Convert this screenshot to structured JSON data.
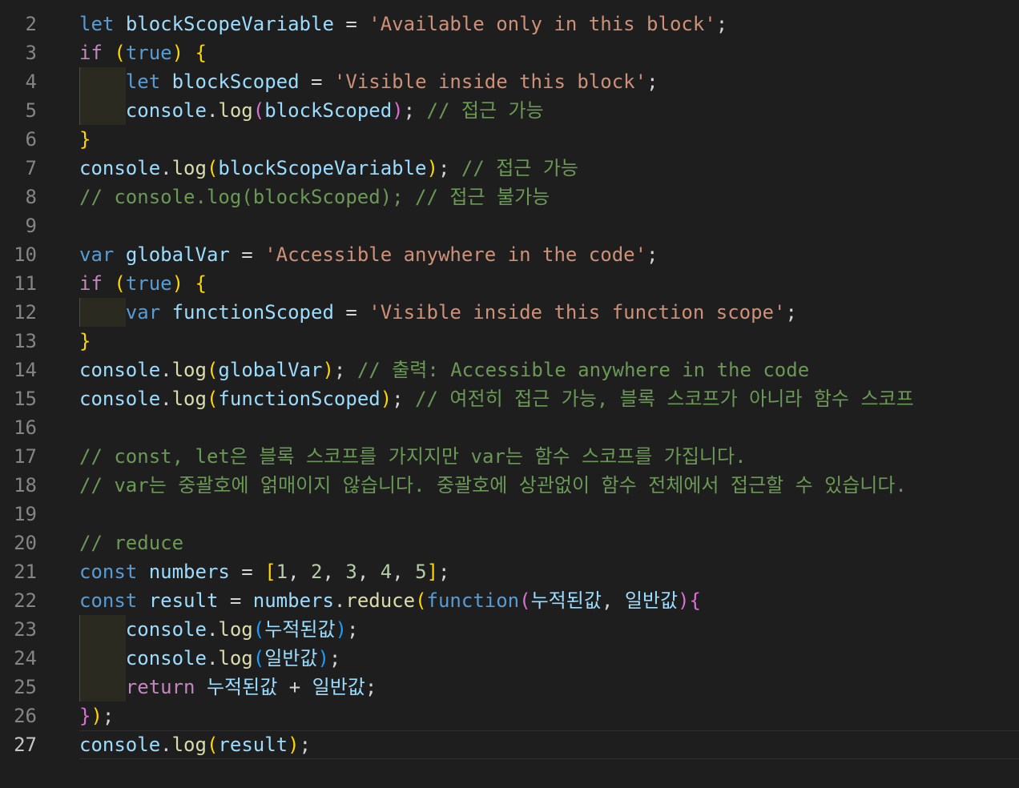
{
  "editor": {
    "language": "javascript",
    "theme": "dark",
    "active_line": 27,
    "lines": [
      {
        "n": "2",
        "tokens": [
          [
            "kw",
            "let"
          ],
          [
            "punc",
            " "
          ],
          [
            "var",
            "blockScopeVariable"
          ],
          [
            "punc",
            " = "
          ],
          [
            "str",
            "'Available only in this block'"
          ],
          [
            "punc",
            ";"
          ]
        ]
      },
      {
        "n": "3",
        "tokens": [
          [
            "ctrl",
            "if"
          ],
          [
            "punc",
            " "
          ],
          [
            "p1",
            "("
          ],
          [
            "kw",
            "true"
          ],
          [
            "p1",
            ")"
          ],
          [
            "punc",
            " "
          ],
          [
            "p1",
            "{"
          ]
        ]
      },
      {
        "n": "4",
        "tokens": [
          [
            "punc",
            "    "
          ],
          [
            "kw",
            "let"
          ],
          [
            "punc",
            " "
          ],
          [
            "var",
            "blockScoped"
          ],
          [
            "punc",
            " = "
          ],
          [
            "str",
            "'Visible inside this block'"
          ],
          [
            "punc",
            ";"
          ]
        ]
      },
      {
        "n": "5",
        "tokens": [
          [
            "punc",
            "    "
          ],
          [
            "var",
            "console"
          ],
          [
            "punc",
            "."
          ],
          [
            "fn",
            "log"
          ],
          [
            "p2",
            "("
          ],
          [
            "var",
            "blockScoped"
          ],
          [
            "p2",
            ")"
          ],
          [
            "punc",
            "; "
          ],
          [
            "cmt",
            "// 접근 가능"
          ]
        ]
      },
      {
        "n": "6",
        "tokens": [
          [
            "p1",
            "}"
          ]
        ]
      },
      {
        "n": "7",
        "tokens": [
          [
            "var",
            "console"
          ],
          [
            "punc",
            "."
          ],
          [
            "fn",
            "log"
          ],
          [
            "p1",
            "("
          ],
          [
            "var",
            "blockScopeVariable"
          ],
          [
            "p1",
            ")"
          ],
          [
            "punc",
            "; "
          ],
          [
            "cmt",
            "// 접근 가능"
          ]
        ]
      },
      {
        "n": "8",
        "tokens": [
          [
            "cmt",
            "// console.log(blockScoped); // 접근 불가능"
          ]
        ]
      },
      {
        "n": "9",
        "tokens": []
      },
      {
        "n": "10",
        "tokens": [
          [
            "kw",
            "var"
          ],
          [
            "punc",
            " "
          ],
          [
            "var",
            "globalVar"
          ],
          [
            "punc",
            " = "
          ],
          [
            "str",
            "'Accessible anywhere in the code'"
          ],
          [
            "punc",
            ";"
          ]
        ]
      },
      {
        "n": "11",
        "tokens": [
          [
            "ctrl",
            "if"
          ],
          [
            "punc",
            " "
          ],
          [
            "p1",
            "("
          ],
          [
            "kw",
            "true"
          ],
          [
            "p1",
            ")"
          ],
          [
            "punc",
            " "
          ],
          [
            "p1",
            "{"
          ]
        ]
      },
      {
        "n": "12",
        "tokens": [
          [
            "punc",
            "    "
          ],
          [
            "kw",
            "var"
          ],
          [
            "punc",
            " "
          ],
          [
            "var",
            "functionScoped"
          ],
          [
            "punc",
            " = "
          ],
          [
            "str",
            "'Visible inside this function scope'"
          ],
          [
            "punc",
            ";"
          ]
        ]
      },
      {
        "n": "13",
        "tokens": [
          [
            "p1",
            "}"
          ]
        ]
      },
      {
        "n": "14",
        "tokens": [
          [
            "var",
            "console"
          ],
          [
            "punc",
            "."
          ],
          [
            "fn",
            "log"
          ],
          [
            "p1",
            "("
          ],
          [
            "var",
            "globalVar"
          ],
          [
            "p1",
            ")"
          ],
          [
            "punc",
            "; "
          ],
          [
            "cmt",
            "// 출력: Accessible anywhere in the code"
          ]
        ]
      },
      {
        "n": "15",
        "tokens": [
          [
            "var",
            "console"
          ],
          [
            "punc",
            "."
          ],
          [
            "fn",
            "log"
          ],
          [
            "p1",
            "("
          ],
          [
            "var",
            "functionScoped"
          ],
          [
            "p1",
            ")"
          ],
          [
            "punc",
            "; "
          ],
          [
            "cmt",
            "// 여전히 접근 가능, 블록 스코프가 아니라 함수 스코프"
          ]
        ]
      },
      {
        "n": "16",
        "tokens": []
      },
      {
        "n": "17",
        "tokens": [
          [
            "cmt",
            "// const, let은 블록 스코프를 가지지만 var는 함수 스코프를 가집니다."
          ]
        ]
      },
      {
        "n": "18",
        "tokens": [
          [
            "cmt",
            "// var는 중괄호에 얽매이지 않습니다. 중괄호에 상관없이 함수 전체에서 접근할 수 있습니다."
          ]
        ]
      },
      {
        "n": "19",
        "tokens": []
      },
      {
        "n": "20",
        "tokens": [
          [
            "cmt",
            "// reduce"
          ]
        ]
      },
      {
        "n": "21",
        "tokens": [
          [
            "kw",
            "const"
          ],
          [
            "punc",
            " "
          ],
          [
            "var",
            "numbers"
          ],
          [
            "punc",
            " = "
          ],
          [
            "p1",
            "["
          ],
          [
            "num",
            "1"
          ],
          [
            "punc",
            ", "
          ],
          [
            "num",
            "2"
          ],
          [
            "punc",
            ", "
          ],
          [
            "num",
            "3"
          ],
          [
            "punc",
            ", "
          ],
          [
            "num",
            "4"
          ],
          [
            "punc",
            ", "
          ],
          [
            "num",
            "5"
          ],
          [
            "p1",
            "]"
          ],
          [
            "punc",
            ";"
          ]
        ]
      },
      {
        "n": "22",
        "tokens": [
          [
            "kw",
            "const"
          ],
          [
            "punc",
            " "
          ],
          [
            "var",
            "result"
          ],
          [
            "punc",
            " = "
          ],
          [
            "var",
            "numbers"
          ],
          [
            "punc",
            "."
          ],
          [
            "fn",
            "reduce"
          ],
          [
            "p1",
            "("
          ],
          [
            "kw",
            "function"
          ],
          [
            "p2",
            "("
          ],
          [
            "var",
            "누적된값"
          ],
          [
            "punc",
            ", "
          ],
          [
            "var",
            "일반값"
          ],
          [
            "p2",
            ")"
          ],
          [
            "p2",
            "{"
          ]
        ]
      },
      {
        "n": "23",
        "tokens": [
          [
            "punc",
            "    "
          ],
          [
            "var",
            "console"
          ],
          [
            "punc",
            "."
          ],
          [
            "fn",
            "log"
          ],
          [
            "p3",
            "("
          ],
          [
            "var",
            "누적된값"
          ],
          [
            "p3",
            ")"
          ],
          [
            "punc",
            ";"
          ]
        ]
      },
      {
        "n": "24",
        "tokens": [
          [
            "punc",
            "    "
          ],
          [
            "var",
            "console"
          ],
          [
            "punc",
            "."
          ],
          [
            "fn",
            "log"
          ],
          [
            "p3",
            "("
          ],
          [
            "var",
            "일반값"
          ],
          [
            "p3",
            ")"
          ],
          [
            "punc",
            ";"
          ]
        ]
      },
      {
        "n": "25",
        "tokens": [
          [
            "punc",
            "    "
          ],
          [
            "ctrl",
            "return"
          ],
          [
            "punc",
            " "
          ],
          [
            "var",
            "누적된값"
          ],
          [
            "punc",
            " + "
          ],
          [
            "var",
            "일반값"
          ],
          [
            "punc",
            ";"
          ]
        ]
      },
      {
        "n": "26",
        "tokens": [
          [
            "p2",
            "}"
          ],
          [
            "p1",
            ")"
          ],
          [
            "punc",
            ";"
          ]
        ]
      },
      {
        "n": "27",
        "tokens": [
          [
            "var",
            "console"
          ],
          [
            "punc",
            "."
          ],
          [
            "fn",
            "log"
          ],
          [
            "p1",
            "("
          ],
          [
            "var",
            "result"
          ],
          [
            "p1",
            ")"
          ],
          [
            "punc",
            ";"
          ]
        ]
      }
    ]
  }
}
